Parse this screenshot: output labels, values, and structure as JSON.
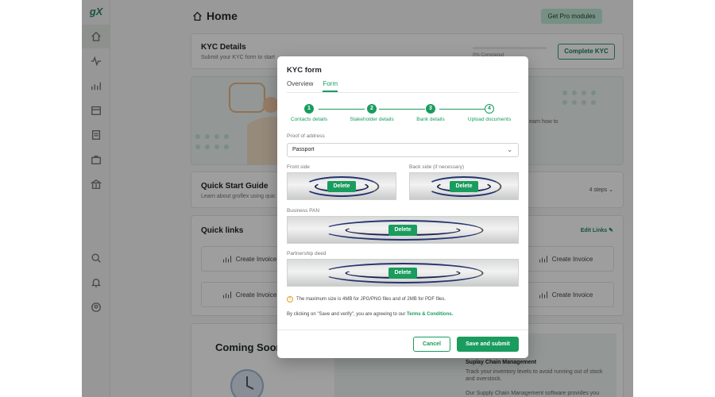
{
  "app": {
    "logo_text": "gX"
  },
  "topbar": {
    "page_title": "Home",
    "pro_button": "Get Pro modules",
    "help": "?"
  },
  "kyc_card": {
    "title": "KYC Details",
    "subtitle": "Submit your KYC form to start",
    "progress_text": "0% Completed",
    "progress_value": 0,
    "button": "Complete KYC"
  },
  "banner": {
    "side_text": "earn how to"
  },
  "quick_start": {
    "title": "Quick Start Guide",
    "subtitle": "Learn about groflex using quic",
    "steps": "4 steps"
  },
  "quick_links": {
    "title": "Quick links",
    "edit": "Edit Links",
    "tiles": [
      "Create Invoice",
      "Create Invoice",
      "Create Invoice",
      "Create Invoice"
    ]
  },
  "coming_soon": {
    "title": "Coming Soon",
    "scm_title": "Suplay Chain Management",
    "scm_desc": "Track your inventory levels to avoid running out of stock and overstock.",
    "scm_desc2": "Our Supply Chain Management software provides you"
  },
  "modal": {
    "title": "KYC form",
    "tabs": [
      "Overview",
      "Form"
    ],
    "active_tab": "Form",
    "steps": [
      {
        "n": "1",
        "label": "Contacts details",
        "done": true
      },
      {
        "n": "2",
        "label": "Stakeholder details",
        "done": true
      },
      {
        "n": "3",
        "label": "Bank details",
        "done": true
      },
      {
        "n": "4",
        "label": "Upload documents",
        "done": false
      }
    ],
    "proof_label": "Proof of address",
    "proof_value": "Passport",
    "front_label": "Front side",
    "back_label": "Back side (if necessary)",
    "pan_label": "Business PAN",
    "deed_label": "Partnership deed",
    "delete_label": "Delete",
    "size_note": "The maximum size is 4MB for JPG/PNG files and of 2MB for PDF files.",
    "agree_prefix": "By clicking on \"Save and verify\", you are agreeing to our",
    "agree_link": "Terms & Conditions.",
    "cancel": "Cancel",
    "submit": "Save and submit"
  },
  "colors": {
    "accent": "#1a9c5e",
    "pro_bg": "#bfe8d7"
  }
}
